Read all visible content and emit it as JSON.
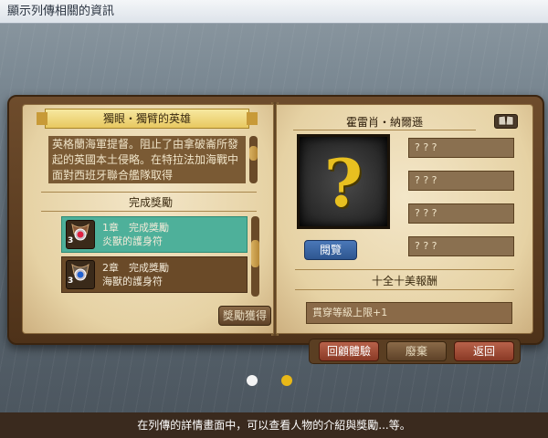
{
  "window": {
    "title": "顯示列傳相關的資訊"
  },
  "left_page": {
    "title": "獨眼・獨臂的英雄",
    "description": "英格蘭海軍提督。阻止了由拿破崙所發起的英國本土侵略。在特拉法加海戰中面對西班牙聯合艦隊取得",
    "rewards_header": "完成獎勵",
    "rewards": [
      {
        "chapter": "1章　完成獎勵",
        "item": "炎獸的護身符",
        "qty": "3",
        "icon": "amulet-red-gem-icon",
        "selected": true
      },
      {
        "chapter": "2章　完成獎勵",
        "item": "海獸的護身符",
        "qty": "3",
        "icon": "amulet-blue-gem-icon",
        "selected": false
      }
    ],
    "claim_button": "獎勵獲得",
    "desc_scroll_fraction": 0.3,
    "list_scroll_fraction": 0.45
  },
  "right_page": {
    "name": "霍雷肖・納爾遜",
    "book_icon": "book-icon",
    "portrait_placeholder": "?",
    "view_button": "閱覽",
    "stats": [
      "? ? ?",
      "? ? ?",
      "? ? ?",
      "? ? ?"
    ],
    "bonus_header": "十全十美報酬",
    "bonus_value": "貫穿等級上限+1"
  },
  "actions": {
    "replay": "回顧體驗",
    "discard": "廢棄",
    "back": "返回"
  },
  "pagination": {
    "total": 2,
    "current": 2,
    "active_color": "#e8b818",
    "inactive_color": "#f4f4f4"
  },
  "footer": {
    "caption": "在列傳的詳情畫面中，可以查看人物的介紹與獎勵...等。"
  },
  "colors": {
    "selected_row": "#4eb09a",
    "panel_brown": "#6a4a28",
    "question_mark": "#e8c020"
  }
}
